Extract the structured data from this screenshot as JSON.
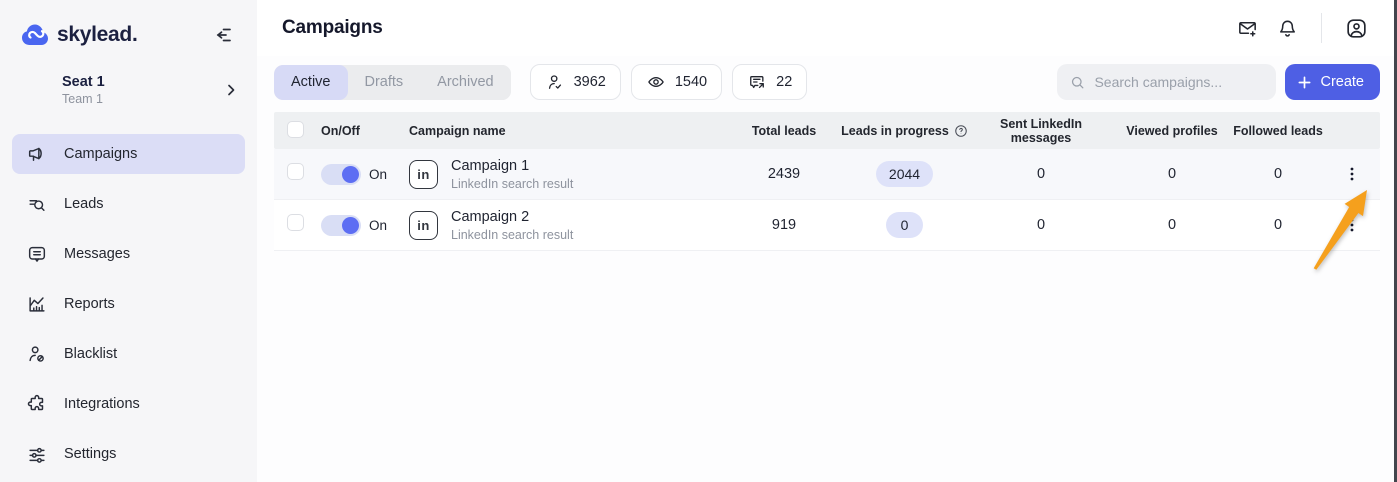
{
  "brand": {
    "name": "skylead."
  },
  "sidebar": {
    "seat": {
      "name": "Seat 1",
      "team": "Team 1"
    },
    "items": [
      {
        "label": "Campaigns",
        "icon": "megaphone-icon",
        "active": true
      },
      {
        "label": "Leads",
        "icon": "leads-search-icon",
        "active": false
      },
      {
        "label": "Messages",
        "icon": "message-bubble-icon",
        "active": false
      },
      {
        "label": "Reports",
        "icon": "chart-icon",
        "active": false
      },
      {
        "label": "Blacklist",
        "icon": "person-block-icon",
        "active": false
      },
      {
        "label": "Integrations",
        "icon": "puzzle-icon",
        "active": false
      },
      {
        "label": "Settings",
        "icon": "sliders-icon",
        "active": false
      }
    ]
  },
  "header": {
    "title": "Campaigns"
  },
  "filters": {
    "tabs": {
      "active": "Active",
      "drafts": "Drafts",
      "archived": "Archived"
    },
    "selected_tab": "Active",
    "stats": [
      {
        "icon": "person-check-icon",
        "value": "3962"
      },
      {
        "icon": "eye-icon",
        "value": "1540"
      },
      {
        "icon": "message-share-icon",
        "value": "22"
      }
    ]
  },
  "search": {
    "placeholder": "Search campaigns..."
  },
  "create_button": {
    "label": "Create"
  },
  "table": {
    "columns": {
      "onoff": "On/Off",
      "name": "Campaign name",
      "total": "Total leads",
      "progress": "Leads in progress",
      "sent": "Sent LinkedIn messages",
      "viewed": "Viewed profiles",
      "followed": "Followed leads"
    },
    "rows": [
      {
        "toggle": "On",
        "source_icon": "linkedin-icon",
        "source_icon_text": "in",
        "name": "Campaign 1",
        "subtitle": "LinkedIn search result",
        "total_leads": "2439",
        "leads_in_progress": "2044",
        "sent_messages": "0",
        "viewed_profiles": "0",
        "followed_leads": "0"
      },
      {
        "toggle": "On",
        "source_icon": "linkedin-icon",
        "source_icon_text": "in",
        "name": "Campaign 2",
        "subtitle": "LinkedIn search result",
        "total_leads": "919",
        "leads_in_progress": "0",
        "sent_messages": "0",
        "viewed_profiles": "0",
        "followed_leads": "0"
      }
    ]
  },
  "colors": {
    "primary_indigo": "#4E5FE4",
    "toggle_knob": "#5D6EF3",
    "badge_bg": "#DEE2F9",
    "active_tab_bg": "#D7DAF6",
    "sidebar_active_bg": "#DBDDF6",
    "sidebar_bg": "#F6F6F8",
    "table_header_bg": "#EEF0F2",
    "logo_blue": "#4A66F0",
    "navy_text": "#1B2040",
    "arrow_orange": "#F5A01D"
  },
  "annotation": {
    "type": "arrow",
    "target": "row-1-menu",
    "color": "#F5A01D"
  }
}
